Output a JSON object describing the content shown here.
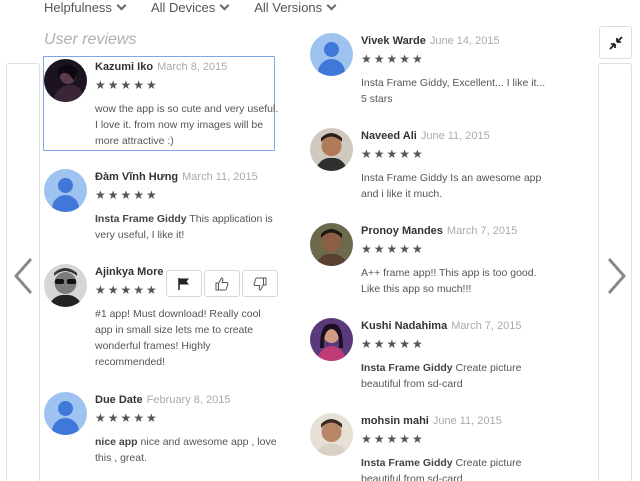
{
  "filters": [
    {
      "label": "Helpfulness"
    },
    {
      "label": "All Devices"
    },
    {
      "label": "All Versions"
    }
  ],
  "section_title": "User reviews",
  "stars": "★★★★★",
  "left_column": [
    {
      "author": "Kazumi Iko",
      "date": "March 8, 2015",
      "lead": "",
      "text": "wow the app is so cute and very useful. I love it. from now my images will be more attractive :)",
      "avatar": "photo-dark"
    },
    {
      "author": "Đàm Vĩnh Hưng",
      "date": "March 11, 2015",
      "lead": "Insta Frame Giddy",
      "text": " This application is very useful, I like it!",
      "avatar": "default"
    },
    {
      "author": "Ajinkya More",
      "date": "",
      "lead": "",
      "text": "#1 app! Must download! Really cool app in small size lets me to create wonderful frames! Highly recommended!",
      "avatar": "photo-sunglasses"
    },
    {
      "author": "Due Date",
      "date": "February 8, 2015",
      "lead": "nice app",
      "text": " nice and awesome app , love this , great.",
      "avatar": "default"
    }
  ],
  "right_column": [
    {
      "author": "Vivek Warde",
      "date": "June 14, 2015",
      "lead": "",
      "text": "Insta Frame Giddy, Excellent... I like it... 5 stars",
      "avatar": "default"
    },
    {
      "author": "Naveed Ali",
      "date": "June 11, 2015",
      "lead": "",
      "text": "Insta Frame Giddy Is an awesome app and i like it much.",
      "avatar": "photo-man"
    },
    {
      "author": "Pronoy Mandes",
      "date": "March 7, 2015",
      "lead": "",
      "text": "A++ frame app!! This app is too good. Like this app so much!!!",
      "avatar": "photo-boy"
    },
    {
      "author": "Kushi Nadahima",
      "date": "March 7, 2015",
      "lead": "Insta Frame Giddy",
      "text": " Create picture beautiful from sd-card",
      "avatar": "photo-girl"
    },
    {
      "author": "mohsin mahi",
      "date": "June 11, 2015",
      "lead": "Insta Frame Giddy",
      "text": " Create picture beautiful from sd-card",
      "avatar": "photo-man2"
    }
  ],
  "icons": {
    "flag": "flag-icon",
    "thumbs_up": "thumbs-up-icon",
    "thumbs_down": "thumbs-down-icon",
    "collapse": "collapse-icon",
    "prev": "chevron-left-icon",
    "next": "chevron-right-icon"
  },
  "colors": {
    "highlight_border": "#7fa6e8",
    "avatar_default_bg": "#9fc3f0",
    "avatar_default_fg": "#3f78d8",
    "star": "#555555"
  }
}
